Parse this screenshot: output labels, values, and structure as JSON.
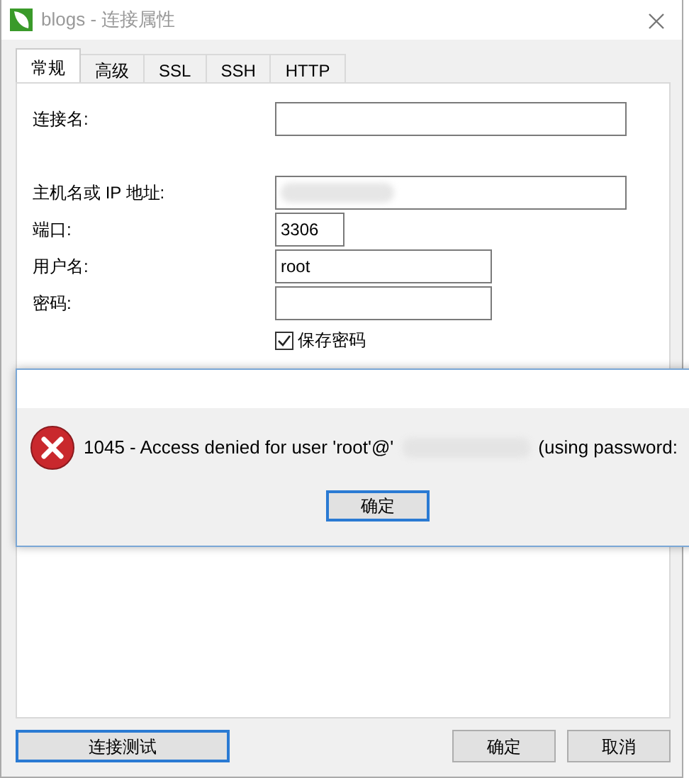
{
  "window": {
    "title": "blogs - 连接属性"
  },
  "tabs": [
    {
      "label": "常规",
      "selected": true
    },
    {
      "label": "高级",
      "selected": false
    },
    {
      "label": "SSL",
      "selected": false
    },
    {
      "label": "SSH",
      "selected": false
    },
    {
      "label": "HTTP",
      "selected": false
    }
  ],
  "fields": [
    {
      "label": "连接名:",
      "kind": "wide"
    },
    {
      "kind": "gap"
    },
    {
      "label": "主机名或 IP 地址:",
      "kind": "wide",
      "redacted": true
    },
    {
      "label": "端口:",
      "kind": "short",
      "value": "3306"
    },
    {
      "label": "用户名:",
      "kind": "medium",
      "value": "root"
    },
    {
      "label": "密码:",
      "kind": "medium"
    }
  ],
  "save_password": {
    "label": "保存密码",
    "checked": true
  },
  "error_dialog": {
    "message_start": "1045 - Access denied for user 'root'@'",
    "message_end": "(using password:",
    "button": "确定"
  },
  "buttons": [
    {
      "label": "连接测试",
      "kind": "left",
      "focused": true
    },
    {
      "label": "确定",
      "kind": "right",
      "focused": false
    },
    {
      "label": "取消",
      "kind": "right",
      "focused": false
    }
  ]
}
